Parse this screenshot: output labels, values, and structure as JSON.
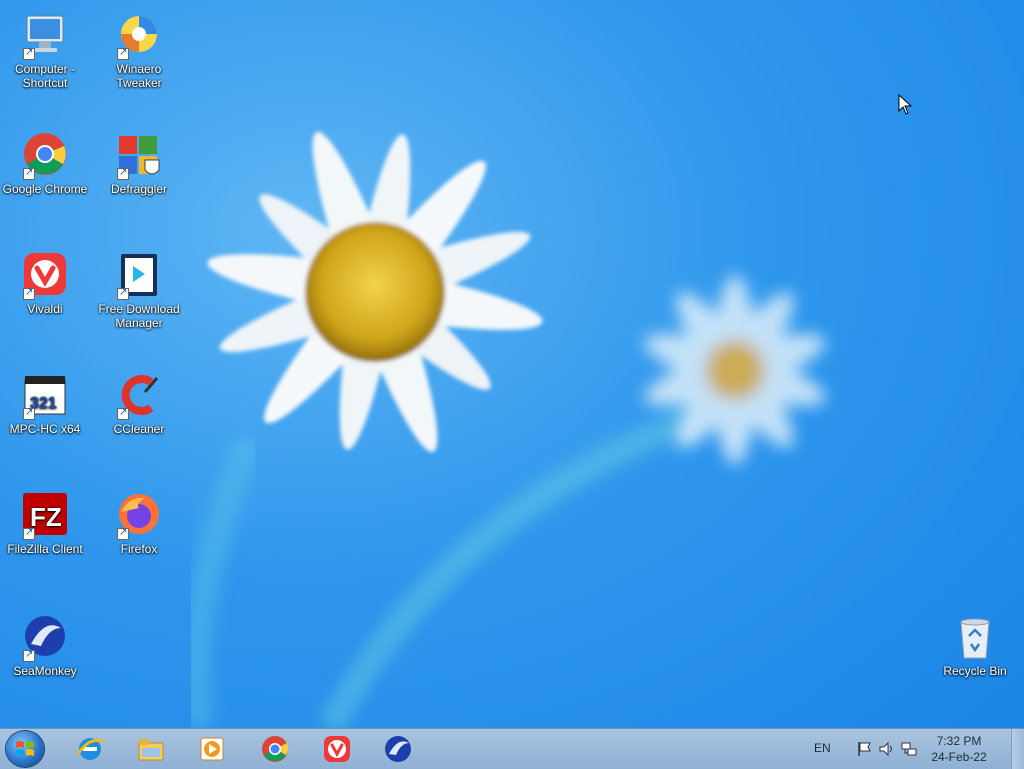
{
  "desktop": {
    "icons": [
      {
        "label": "Computer - Shortcut",
        "icon": "computer-icon"
      },
      {
        "label": "Winaero Tweaker",
        "icon": "winaero-icon"
      },
      {
        "label": "Google Chrome",
        "icon": "chrome-icon"
      },
      {
        "label": "Defraggler",
        "icon": "defraggler-icon"
      },
      {
        "label": "Vivaldi",
        "icon": "vivaldi-icon"
      },
      {
        "label": "Free Download Manager",
        "icon": "fdm-icon"
      },
      {
        "label": "MPC-HC x64",
        "icon": "mpc-icon"
      },
      {
        "label": "CCleaner",
        "icon": "ccleaner-icon"
      },
      {
        "label": "FileZilla Client",
        "icon": "filezilla-icon"
      },
      {
        "label": "Firefox",
        "icon": "firefox-icon"
      },
      {
        "label": "SeaMonkey",
        "icon": "seamonkey-icon"
      },
      {
        "label": "Recycle Bin",
        "icon": "recycle-bin-icon"
      }
    ]
  },
  "taskbar": {
    "pinned": [
      "internet-explorer-icon",
      "file-explorer-icon",
      "media-player-icon",
      "chrome-icon",
      "vivaldi-icon",
      "seamonkey-icon"
    ],
    "tray": {
      "language": "EN",
      "time": "7:32 PM",
      "date": "24-Feb-22"
    }
  },
  "colors": {
    "desktop_blue": "#2f97ec",
    "taskbar": "#a9c4df"
  }
}
